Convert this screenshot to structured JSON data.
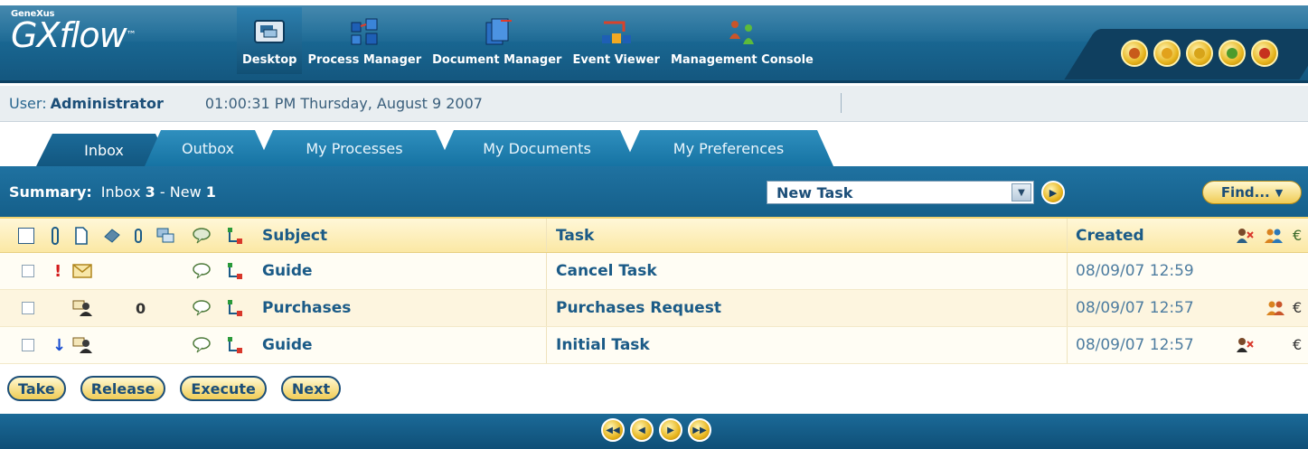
{
  "header": {
    "logo_small": "GeneXus",
    "logo_main": "GXflow",
    "logo_tm": "™",
    "apps": [
      {
        "label": "Desktop",
        "icon": "desktop-icon",
        "active": true
      },
      {
        "label": "Process Manager",
        "icon": "process-manager-icon",
        "active": false
      },
      {
        "label": "Document Manager",
        "icon": "document-manager-icon",
        "active": false
      },
      {
        "label": "Event Viewer",
        "icon": "event-viewer-icon",
        "active": false
      },
      {
        "label": "Management Console",
        "icon": "management-console-icon",
        "active": false
      }
    ],
    "right_buttons": [
      "back-icon",
      "window-icon",
      "help-icon",
      "info-icon",
      "close-icon"
    ]
  },
  "userbar": {
    "user_label": "User:",
    "user_name": "Administrator",
    "datetime": "01:00:31 PM Thursday, August 9 2007"
  },
  "tabs": [
    "Inbox",
    "Outbox",
    "My Processes",
    "My Documents",
    "My Preferences"
  ],
  "summary": {
    "label": "Summary:",
    "inbox_label": "Inbox",
    "inbox_count": "3",
    "dash": "-",
    "new_label": "New",
    "new_count": "1",
    "task_select": "New Task",
    "find_label": "Find..."
  },
  "table": {
    "columns": {
      "subject": "Subject",
      "task": "Task",
      "created": "Created"
    },
    "header_icons": [
      "priority-icon",
      "document-icon",
      "attachment-icon",
      "clip-icon",
      "messages-icon",
      "comment-icon",
      "diagram-icon"
    ],
    "rows": [
      {
        "priority": "!",
        "type_icon": "envelope-icon",
        "attach": "",
        "subject": "Guide",
        "task": "Cancel Task",
        "created": "08/09/07 12:59",
        "assign_icons": []
      },
      {
        "priority": "",
        "type_icon": "users-icon",
        "attach": "0",
        "subject": "Purchases",
        "task": "Purchases Request",
        "created": "08/09/07 12:57",
        "assign_icons": [
          "group-icon",
          "euro-icon"
        ]
      },
      {
        "priority": "↓",
        "type_icon": "users-icon",
        "attach": "",
        "subject": "Guide",
        "task": "Initial Task",
        "created": "08/09/07 12:57",
        "assign_icons": [
          "unassign-icon",
          "euro-icon"
        ]
      }
    ]
  },
  "actions": [
    "Take",
    "Release",
    "Execute",
    "Next"
  ],
  "pager": [
    "first-page-icon",
    "prev-page-icon",
    "next-page-icon",
    "last-page-icon"
  ],
  "colors": {
    "header_blue": "#1a6a96",
    "tab_blue": "#2f8fbe",
    "accent_gold": "#e7b51f",
    "table_header": "#fbe8a4",
    "text_blue": "#1b5b87"
  }
}
